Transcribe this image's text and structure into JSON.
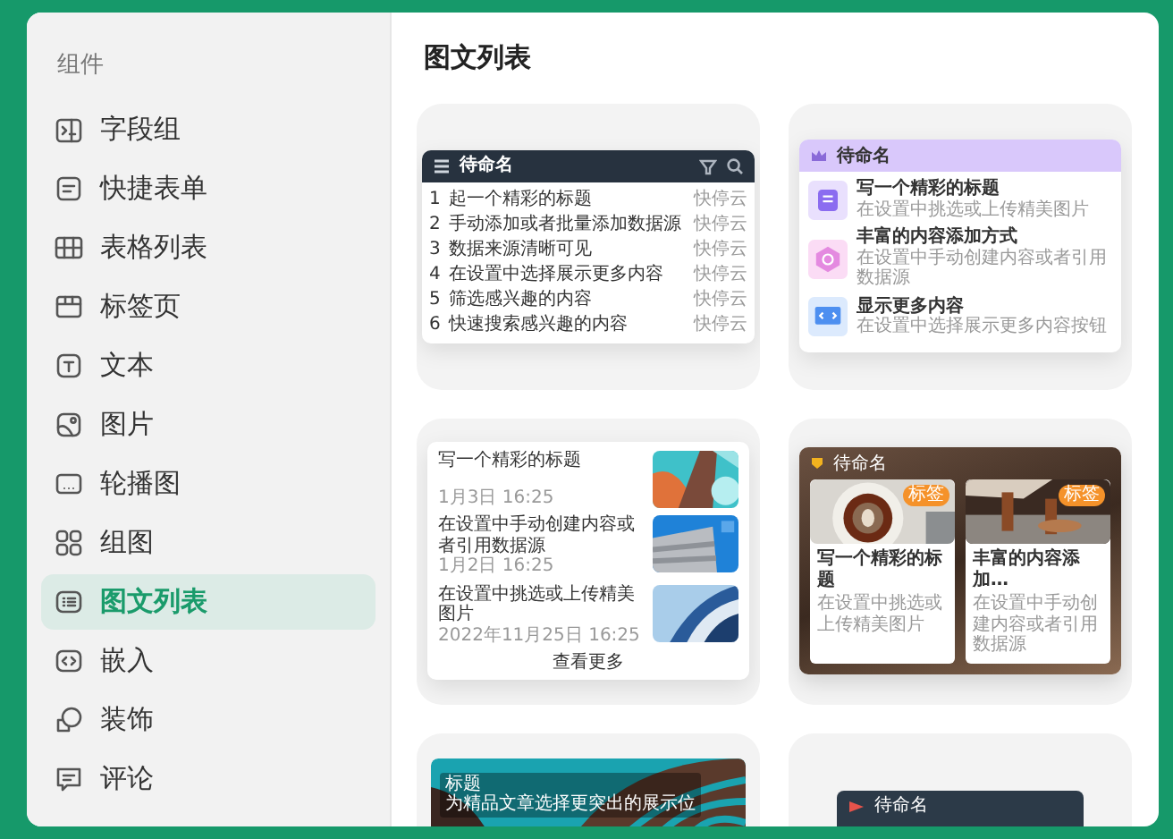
{
  "sidebar": {
    "heading": "组件",
    "items": [
      {
        "label": "字段组",
        "selected": false
      },
      {
        "label": "快捷表单",
        "selected": false
      },
      {
        "label": "表格列表",
        "selected": false
      },
      {
        "label": "标签页",
        "selected": false
      },
      {
        "label": "文本",
        "selected": false
      },
      {
        "label": "图片",
        "selected": false
      },
      {
        "label": "轮播图",
        "selected": false
      },
      {
        "label": "组图",
        "selected": false
      },
      {
        "label": "图文列表",
        "selected": true
      },
      {
        "label": "嵌入",
        "selected": false
      },
      {
        "label": "装饰",
        "selected": false
      },
      {
        "label": "评论",
        "selected": false
      }
    ]
  },
  "main": {
    "title": "图文列表",
    "previews": [
      {
        "kind": "table_list",
        "header": "待命名",
        "rows": [
          {
            "index": "1",
            "text": "起一个精彩的标题",
            "tag": "快停云"
          },
          {
            "index": "2",
            "text": "手动添加或者批量添加数据源",
            "tag": "快停云"
          },
          {
            "index": "3",
            "text": "数据来源清晰可见",
            "tag": "快停云"
          },
          {
            "index": "4",
            "text": "在设置中选择展示更多内容",
            "tag": "快停云"
          },
          {
            "index": "5",
            "text": "筛选感兴趣的内容",
            "tag": "快停云"
          },
          {
            "index": "6",
            "text": "快速搜索感兴趣的内容",
            "tag": "快停云"
          }
        ]
      },
      {
        "kind": "icon_list",
        "header": "待命名",
        "items": [
          {
            "title": "写一个精彩的标题",
            "subtitle": "在设置中挑选或上传精美图片",
            "color": "#e9e0fd"
          },
          {
            "title": "丰富的内容添加方式",
            "subtitle": "在设置中手动创建内容或者引用数据源",
            "color": "#fbdcf5"
          },
          {
            "title": "显示更多内容",
            "subtitle": "在设置中选择展示更多内容按钮",
            "color": "#dceafd"
          }
        ]
      },
      {
        "kind": "news_list",
        "items": [
          {
            "title": "写一个精彩的标题",
            "time": "1月3日 16:25"
          },
          {
            "title": "在设置中手动创建内容或者引用数据源",
            "time": "1月2日 16:25"
          },
          {
            "title": "在设置中挑选或上传精美图片",
            "time": "2022年11月25日 16:25"
          }
        ],
        "more": "查看更多"
      },
      {
        "kind": "card_grid",
        "header": "待命名",
        "cards": [
          {
            "tag": "标签",
            "title": "写一个精彩的标题",
            "subtitle": "在设置中挑选或上传精美图片"
          },
          {
            "tag": "标签",
            "title": "丰富的内容添加…",
            "subtitle": "在设置中手动创建内容或者引用数据源"
          }
        ]
      },
      {
        "kind": "banner",
        "label": "标题",
        "title": "为精品文章选择更突出的展示位"
      },
      {
        "kind": "header_only",
        "header": "待命名"
      }
    ]
  }
}
